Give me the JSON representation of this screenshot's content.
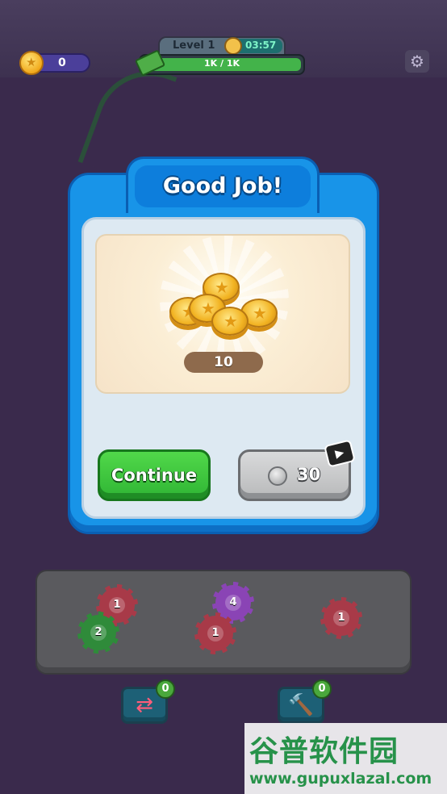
{
  "hud": {
    "coins": "0",
    "level": "Level 1",
    "timer": "03:57",
    "progress_text": "1K / 1K",
    "progress_fraction": 1.0
  },
  "modal": {
    "title": "Good Job!",
    "reward_amount": "10",
    "continue_label": "Continue",
    "ad_cost": "30"
  },
  "tray": {
    "gears": [
      "1",
      "2",
      "4",
      "1",
      "1"
    ]
  },
  "boosters": {
    "swap_count": "0",
    "hammer_count": "0"
  },
  "watermark": {
    "title": "谷普软件园",
    "url": "www.gupuxlazal.com"
  },
  "colors": {
    "modal_blue": "#1894e8",
    "continue_green": "#2fb534",
    "gear_red": "#a83a48",
    "gear_green": "#2f8b3a",
    "gear_purple": "#8a44b5"
  }
}
